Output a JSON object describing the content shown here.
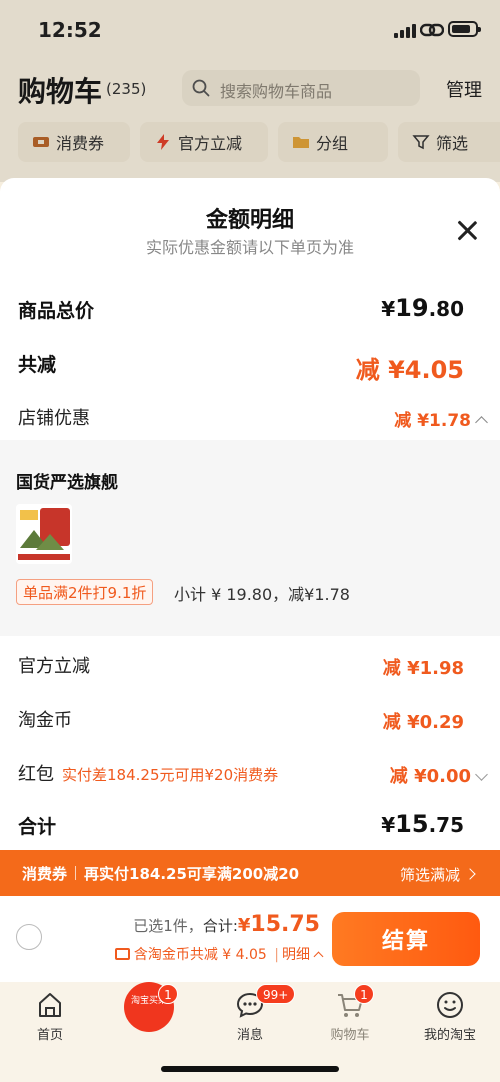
{
  "status_bar": {
    "time": "12:52"
  },
  "header": {
    "title": "购物车",
    "count": "(235)",
    "search_placeholder": "搜索购物车商品",
    "manage": "管理"
  },
  "filters": [
    {
      "label": "消费券",
      "icon": "coupon-icon"
    },
    {
      "label": "官方立减",
      "icon": "lightning-icon"
    },
    {
      "label": "分组",
      "icon": "folder-icon"
    },
    {
      "label": "筛选",
      "icon": "filter-icon"
    }
  ],
  "sheet": {
    "title": "金额明细",
    "subtitle": "实际优惠金额请以下单页为准",
    "total_price_label": "商品总价",
    "total_price_symbol": "¥",
    "total_price_int": "19",
    "total_price_dec": ".80",
    "reduced_label": "共减",
    "reduced_value": "减 ¥4.05",
    "shop_discount_label": "店铺优惠",
    "shop_discount_value": "减 ¥1.78",
    "shop": {
      "name": "国货严选旗舰",
      "promo_tag": "单品满2件打9.1折",
      "subtotal": "小计 ¥ 19.80，减¥1.78"
    },
    "official_label": "官方立减",
    "official_value": "减 ¥1.98",
    "coin_label": "淘金币",
    "coin_value": "减 ¥0.29",
    "hongbao_label": "红包",
    "hongbao_note": "实付差184.25元可用¥20消费券",
    "hongbao_value": "减 ¥0.00",
    "sum_label": "合计",
    "sum_symbol": "¥",
    "sum_int": "15",
    "sum_dec": ".75"
  },
  "coupon_banner": {
    "title": "消费券",
    "text": "再实付184.25可享满200减20",
    "action": "筛选满减"
  },
  "checkout": {
    "selected": "已选1件，",
    "total_label": "合计:",
    "total_symbol": "¥",
    "total_value": "15.75",
    "discount": "含淘金币共减 ¥ 4.05",
    "detail": "明细",
    "button": "结算"
  },
  "tabs": [
    {
      "label": "首页",
      "icon": "home-icon"
    },
    {
      "label": "",
      "icon": "promo-icon",
      "badge": "1",
      "promo_text": "淘宝买菜"
    },
    {
      "label": "消息",
      "icon": "message-icon",
      "badge": "99+"
    },
    {
      "label": "购物车",
      "icon": "cart-icon",
      "badge": "1"
    },
    {
      "label": "我的淘宝",
      "icon": "profile-icon"
    }
  ],
  "colors": {
    "accent": "#f05a1e",
    "banner": "#f46a1a"
  }
}
